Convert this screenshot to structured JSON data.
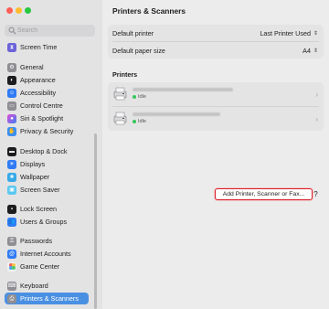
{
  "sidebar": {
    "search_placeholder": "Search",
    "items": [
      {
        "label": "Screen Time",
        "icon": "hourglass-icon",
        "color": "#6c63d8"
      },
      {
        "label": "General",
        "icon": "gear-icon",
        "color": "#8e8e93"
      },
      {
        "label": "Appearance",
        "icon": "appearance-icon",
        "color": "#1c1c1e"
      },
      {
        "label": "Accessibility",
        "icon": "accessibility-icon",
        "color": "#2f7bf5"
      },
      {
        "label": "Control Centre",
        "icon": "control-centre-icon",
        "color": "#8e8e93"
      },
      {
        "label": "Siri & Spotlight",
        "icon": "siri-icon",
        "color": "#c04df0"
      },
      {
        "label": "Privacy & Security",
        "icon": "hand-icon",
        "color": "#3b8ff0"
      },
      {
        "label": "Desktop & Dock",
        "icon": "dock-icon",
        "color": "#1c1c1e"
      },
      {
        "label": "Displays",
        "icon": "sun-icon",
        "color": "#2f7bf5"
      },
      {
        "label": "Wallpaper",
        "icon": "wallpaper-icon",
        "color": "#36a9e8"
      },
      {
        "label": "Screen Saver",
        "icon": "screen-saver-icon",
        "color": "#5ac8f0"
      },
      {
        "label": "Lock Screen",
        "icon": "lock-icon",
        "color": "#1c1c1e"
      },
      {
        "label": "Users & Groups",
        "icon": "users-icon",
        "color": "#2f7bf5"
      },
      {
        "label": "Passwords",
        "icon": "key-icon",
        "color": "#8e8e93"
      },
      {
        "label": "Internet Accounts",
        "icon": "at-icon",
        "color": "#2f7bf5"
      },
      {
        "label": "Game Center",
        "icon": "game-center-icon",
        "color": "#f2f2f2"
      },
      {
        "label": "Keyboard",
        "icon": "keyboard-icon",
        "color": "#8e8e93"
      },
      {
        "label": "Printers & Scanners",
        "icon": "printer-icon",
        "color": "#8e8e93"
      }
    ],
    "selected_color": "#4a90e2"
  },
  "main": {
    "title": "Printers & Scanners",
    "default_printer_label": "Default printer",
    "default_printer_value": "Last Printer Used",
    "paper_size_label": "Default paper size",
    "paper_size_value": "A4",
    "printers_heading": "Printers",
    "printers": [
      {
        "status": "Idle"
      },
      {
        "status": "Idle"
      }
    ],
    "add_button_label": "Add Printer, Scanner or Fax...",
    "help_label": "?",
    "highlight_color": "#d9202a"
  }
}
